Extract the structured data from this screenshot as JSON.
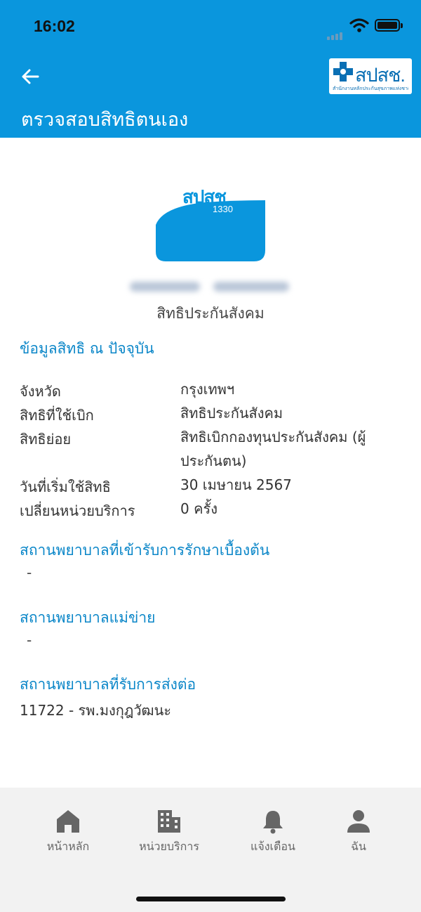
{
  "status_bar": {
    "time": "16:02"
  },
  "header": {
    "title": "ตรวจสอบสิทธิตนเอง",
    "logo_text": "สปสช.",
    "logo_subtitle": "สำนักงานหลักประกันสุขภาพแห่งชาติ"
  },
  "card": {
    "brand": "สปสช",
    "hotline": "1330",
    "right_type": "สิทธิประกันสังคม"
  },
  "current_rights": {
    "title": "ข้อมูลสิทธิ ณ ปัจจุบัน",
    "rows": [
      {
        "label": "จังหวัด",
        "value": "กรุงเทพฯ"
      },
      {
        "label": "สิทธิที่ใช้เบิก",
        "value": "สิทธิประกันสังคม"
      },
      {
        "label": "สิทธิย่อย",
        "value": "สิทธิเบิกกองทุนประกันสังคม (ผู้ประกันตน)"
      },
      {
        "label": "วันที่เริ่มใช้สิทธิ",
        "value": "30 เมษายน 2567"
      },
      {
        "label": "เปลี่ยนหน่วยบริการ",
        "value": "0 ครั้ง"
      }
    ]
  },
  "primary_hospital": {
    "title": "สถานพยาบาลที่เข้ารับการรักษาเบื้องต้น",
    "value": "-"
  },
  "main_hospital": {
    "title": "สถานพยาบาลแม่ข่าย",
    "value": "-"
  },
  "referral_hospital": {
    "title": "สถานพยาบาลที่รับการส่งต่อ",
    "value": "11722 - รพ.มงกุฎวัฒนะ"
  },
  "bottom_nav": {
    "items": [
      {
        "label": "หน้าหลัก",
        "icon": "home-icon"
      },
      {
        "label": "หน่วยบริการ",
        "icon": "building-icon"
      },
      {
        "label": "แจ้งเตือน",
        "icon": "bell-icon"
      },
      {
        "label": "ฉัน",
        "icon": "person-icon"
      }
    ]
  },
  "colors": {
    "primary": "#0a96dd",
    "section_title": "#0a86c8",
    "nav_background": "#f2f2f2"
  }
}
